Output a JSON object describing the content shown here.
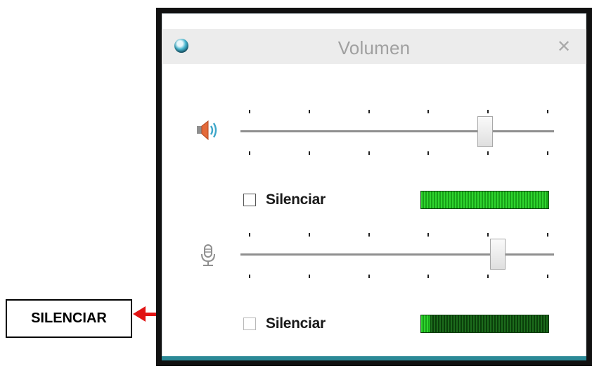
{
  "window": {
    "title": "Volumen",
    "close_symbol": "✕",
    "accent_color": "#2b8996",
    "icon": "app-globe-icon"
  },
  "speaker": {
    "icon": "speaker-icon",
    "level": 0.78,
    "mute_label": "Silenciar",
    "muted": false,
    "meter_level": 1.0,
    "meter_color": "#2fd42f"
  },
  "microphone": {
    "icon": "microphone-icon",
    "level": 0.82,
    "mute_label": "Silenciar",
    "muted": false,
    "meter_level": 0.07,
    "meter_color": "#2fd42f"
  },
  "annotation": {
    "label": "SILENCIAR",
    "arrow_color": "#e11414"
  }
}
